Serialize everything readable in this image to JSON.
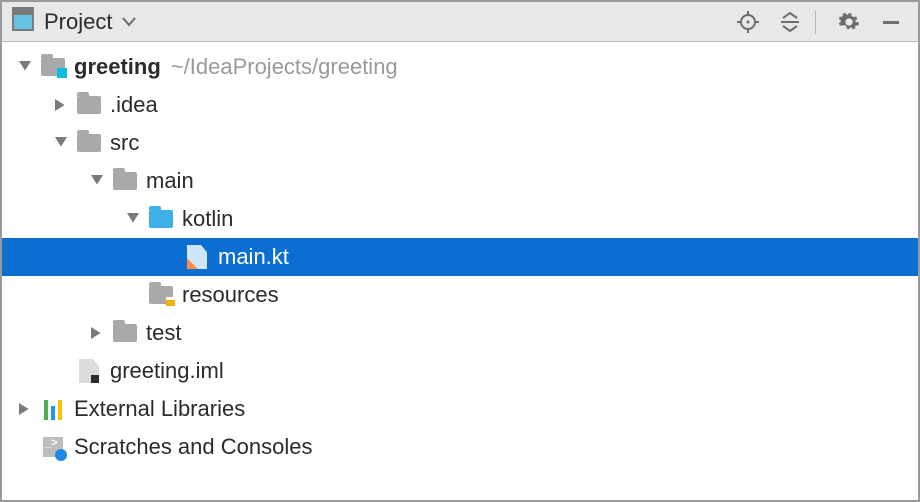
{
  "toolbar": {
    "view_label": "Project"
  },
  "tree": {
    "root": {
      "name": "greeting",
      "path": "~/IdeaProjects/greeting"
    },
    "idea": ".idea",
    "src": "src",
    "main": "main",
    "kotlin": "kotlin",
    "main_kt": "main.kt",
    "resources": "resources",
    "test": "test",
    "iml": "greeting.iml",
    "ext_lib": "External Libraries",
    "scratches": "Scratches and Consoles"
  }
}
